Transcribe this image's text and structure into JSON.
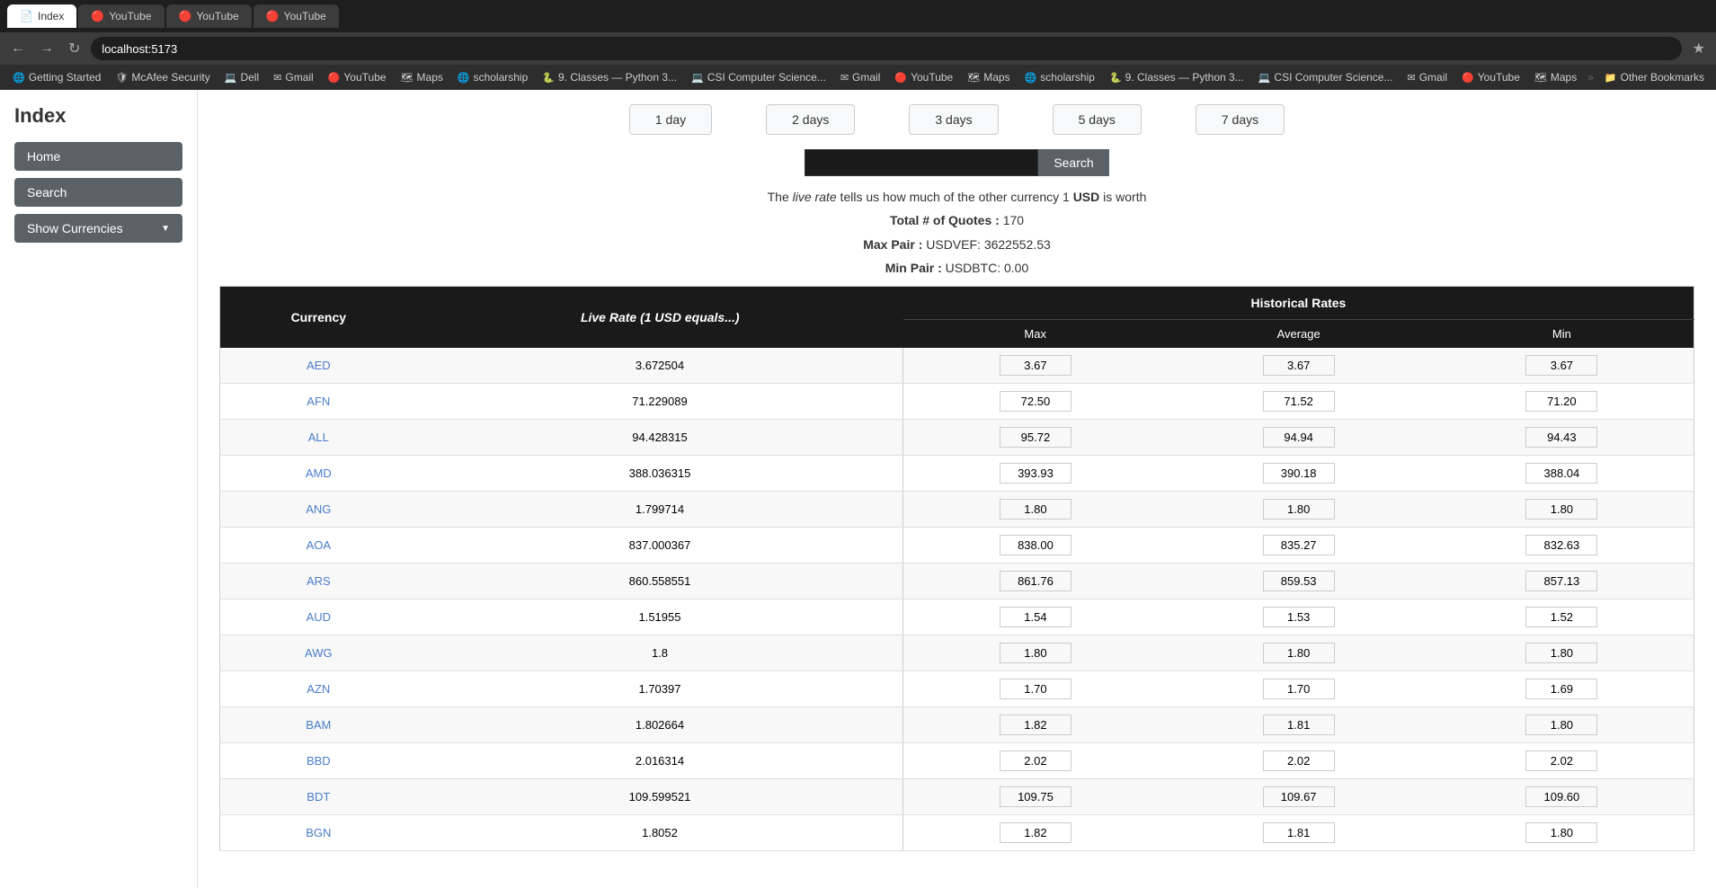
{
  "browser": {
    "url": "localhost:5173",
    "tabs": [
      {
        "label": "Index",
        "active": true,
        "favicon": "📄"
      },
      {
        "label": "YouTube",
        "active": false,
        "favicon": "🔴"
      },
      {
        "label": "YouTube",
        "active": false,
        "favicon": "🔴"
      },
      {
        "label": "YouTube",
        "active": false,
        "favicon": "🔴"
      }
    ],
    "bookmarks": [
      {
        "label": "Getting Started",
        "icon": "🌐"
      },
      {
        "label": "McAfee Security",
        "icon": "🛡"
      },
      {
        "label": "Dell",
        "icon": "💻"
      },
      {
        "label": "Gmail",
        "icon": "✉"
      },
      {
        "label": "YouTube",
        "icon": "🔴"
      },
      {
        "label": "Maps",
        "icon": "🗺"
      },
      {
        "label": "scholarship",
        "icon": "🌐"
      },
      {
        "label": "9. Classes — Python 3...",
        "icon": "🐍"
      },
      {
        "label": "CSI Computer Science...",
        "icon": "💻"
      },
      {
        "label": "Gmail",
        "icon": "✉"
      },
      {
        "label": "YouTube",
        "icon": "🔴"
      },
      {
        "label": "Maps",
        "icon": "🗺"
      },
      {
        "label": "scholarship",
        "icon": "🌐"
      },
      {
        "label": "9. Classes — Python 3...",
        "icon": "🐍"
      },
      {
        "label": "CSI Computer Science...",
        "icon": "💻"
      },
      {
        "label": "Gmail",
        "icon": "✉"
      },
      {
        "label": "YouTube",
        "icon": "🔴"
      },
      {
        "label": "Maps",
        "icon": "🗺"
      },
      {
        "label": "Other Bookmarks",
        "icon": "📁"
      }
    ]
  },
  "sidebar": {
    "title": "Index",
    "home_label": "Home",
    "search_label": "Search",
    "show_currencies_label": "Show Currencies"
  },
  "main": {
    "day_buttons": [
      "1 day",
      "2 days",
      "3 days",
      "5 days",
      "7 days"
    ],
    "search_placeholder": "",
    "search_button_label": "Search",
    "info_line1_pre": "The ",
    "info_live_rate": "live rate",
    "info_line1_post": " tells us how much of the other currency 1 ",
    "info_usd": "USD",
    "info_is_worth": " is worth",
    "total_quotes_label": "Total # of Quotes",
    "total_quotes_value": "170",
    "max_pair_label": "Max Pair",
    "max_pair_value": "USDVEF: 3622552.53",
    "min_pair_label": "Min Pair",
    "min_pair_value": "USDBTC: 0.00",
    "table": {
      "col_currency": "Currency",
      "col_live_rate": "Live Rate (1 USD equals...)",
      "col_historical": "Historical Rates",
      "col_max": "Max",
      "col_average": "Average",
      "col_min": "Min",
      "rows": [
        {
          "currency": "AED",
          "live_rate": "3.672504",
          "max": "3.67",
          "avg": "3.67",
          "min": "3.67"
        },
        {
          "currency": "AFN",
          "live_rate": "71.229089",
          "max": "72.50",
          "avg": "71.52",
          "min": "71.20"
        },
        {
          "currency": "ALL",
          "live_rate": "94.428315",
          "max": "95.72",
          "avg": "94.94",
          "min": "94.43"
        },
        {
          "currency": "AMD",
          "live_rate": "388.036315",
          "max": "393.93",
          "avg": "390.18",
          "min": "388.04"
        },
        {
          "currency": "ANG",
          "live_rate": "1.799714",
          "max": "1.80",
          "avg": "1.80",
          "min": "1.80"
        },
        {
          "currency": "AOA",
          "live_rate": "837.000367",
          "max": "838.00",
          "avg": "835.27",
          "min": "832.63"
        },
        {
          "currency": "ARS",
          "live_rate": "860.558551",
          "max": "861.76",
          "avg": "859.53",
          "min": "857.13"
        },
        {
          "currency": "AUD",
          "live_rate": "1.51955",
          "max": "1.54",
          "avg": "1.53",
          "min": "1.52"
        },
        {
          "currency": "AWG",
          "live_rate": "1.8",
          "max": "1.80",
          "avg": "1.80",
          "min": "1.80"
        },
        {
          "currency": "AZN",
          "live_rate": "1.70397",
          "max": "1.70",
          "avg": "1.70",
          "min": "1.69"
        },
        {
          "currency": "BAM",
          "live_rate": "1.802664",
          "max": "1.82",
          "avg": "1.81",
          "min": "1.80"
        },
        {
          "currency": "BBD",
          "live_rate": "2.016314",
          "max": "2.02",
          "avg": "2.02",
          "min": "2.02"
        },
        {
          "currency": "BDT",
          "live_rate": "109.599521",
          "max": "109.75",
          "avg": "109.67",
          "min": "109.60"
        },
        {
          "currency": "BGN",
          "live_rate": "1.8052",
          "max": "1.82",
          "avg": "1.81",
          "min": "1.80"
        }
      ]
    }
  }
}
